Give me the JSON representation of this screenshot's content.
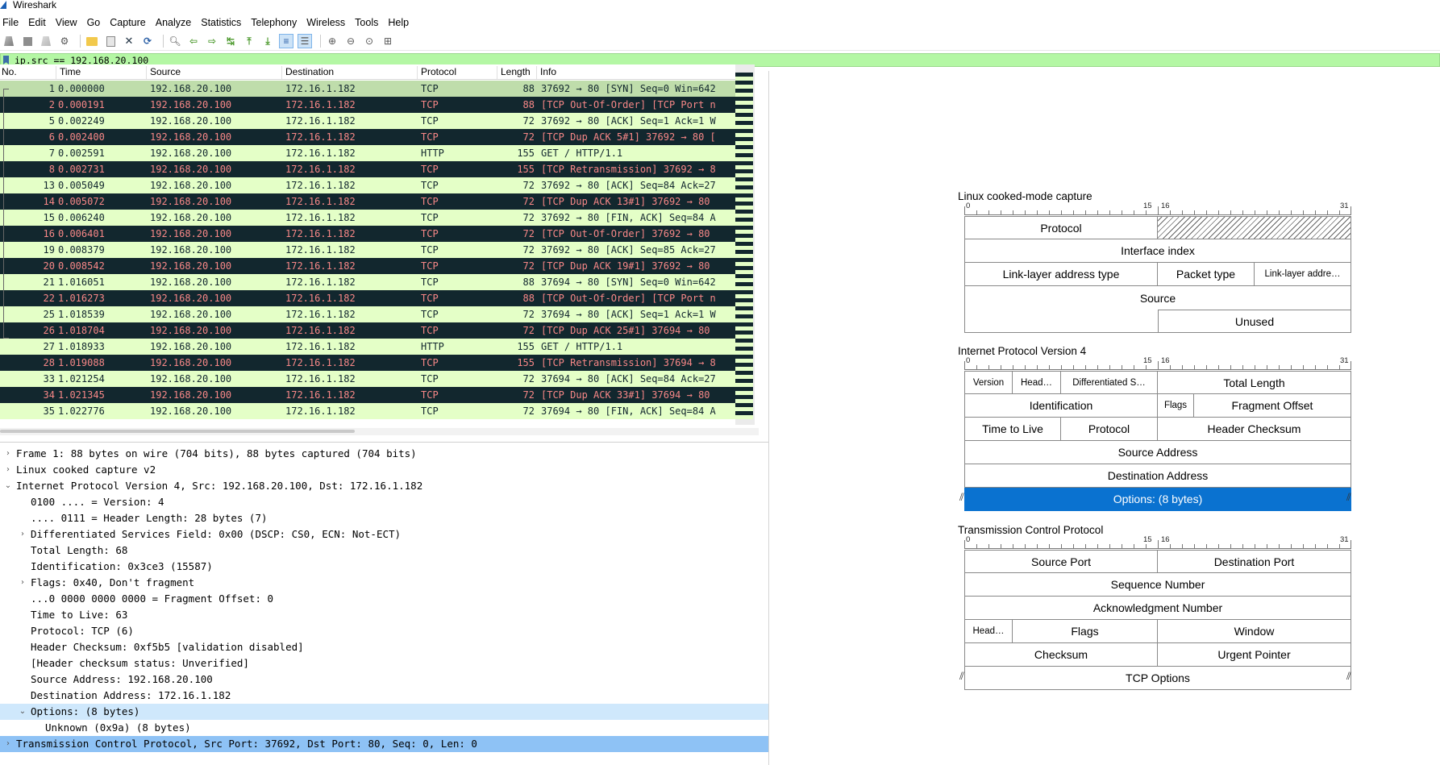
{
  "window": {
    "title": "Wireshark"
  },
  "menu": [
    "File",
    "Edit",
    "View",
    "Go",
    "Capture",
    "Analyze",
    "Statistics",
    "Telephony",
    "Wireless",
    "Tools",
    "Help"
  ],
  "toolbar": {
    "icons": [
      "start-capture-icon",
      "stop-capture-icon",
      "restart-capture-icon",
      "capture-options-icon",
      "open-file-icon",
      "save-file-icon",
      "close-file-icon",
      "reload-file-icon",
      "find-packet-icon",
      "go-back-icon",
      "go-forward-icon",
      "go-to-packet-icon",
      "first-packet-icon",
      "last-packet-icon",
      "auto-scroll-icon",
      "colorize-icon",
      "zoom-in-icon",
      "zoom-out-icon",
      "zoom-normal-icon",
      "resize-columns-icon"
    ]
  },
  "filter": {
    "value": "ip.src == 192.168.20.100"
  },
  "packet_list": {
    "columns": [
      "No.",
      "Time",
      "Source",
      "Destination",
      "Protocol",
      "Length",
      "Info"
    ],
    "rows": [
      {
        "no": "1",
        "time": "0.000000",
        "src": "192.168.20.100",
        "dst": "172.16.1.182",
        "proto": "TCP",
        "len": "88",
        "info": "37692 → 80 [SYN] Seq=0 Win=642",
        "style": "sel"
      },
      {
        "no": "2",
        "time": "0.000191",
        "src": "192.168.20.100",
        "dst": "172.16.1.182",
        "proto": "TCP",
        "len": "88",
        "info": "[TCP Out-Of-Order] [TCP Port n",
        "style": "bad"
      },
      {
        "no": "5",
        "time": "0.002249",
        "src": "192.168.20.100",
        "dst": "172.16.1.182",
        "proto": "TCP",
        "len": "72",
        "info": "37692 → 80 [ACK] Seq=1 Ack=1 W",
        "style": "ok"
      },
      {
        "no": "6",
        "time": "0.002400",
        "src": "192.168.20.100",
        "dst": "172.16.1.182",
        "proto": "TCP",
        "len": "72",
        "info": "[TCP Dup ACK 5#1] 37692 → 80 [",
        "style": "bad"
      },
      {
        "no": "7",
        "time": "0.002591",
        "src": "192.168.20.100",
        "dst": "172.16.1.182",
        "proto": "HTTP",
        "len": "155",
        "info": "GET / HTTP/1.1",
        "style": "ok"
      },
      {
        "no": "8",
        "time": "0.002731",
        "src": "192.168.20.100",
        "dst": "172.16.1.182",
        "proto": "TCP",
        "len": "155",
        "info": "[TCP Retransmission] 37692 → 8",
        "style": "bad"
      },
      {
        "no": "13",
        "time": "0.005049",
        "src": "192.168.20.100",
        "dst": "172.16.1.182",
        "proto": "TCP",
        "len": "72",
        "info": "37692 → 80 [ACK] Seq=84 Ack=27",
        "style": "ok"
      },
      {
        "no": "14",
        "time": "0.005072",
        "src": "192.168.20.100",
        "dst": "172.16.1.182",
        "proto": "TCP",
        "len": "72",
        "info": "[TCP Dup ACK 13#1] 37692 → 80",
        "style": "bad"
      },
      {
        "no": "15",
        "time": "0.006240",
        "src": "192.168.20.100",
        "dst": "172.16.1.182",
        "proto": "TCP",
        "len": "72",
        "info": "37692 → 80 [FIN, ACK] Seq=84 A",
        "style": "ok"
      },
      {
        "no": "16",
        "time": "0.006401",
        "src": "192.168.20.100",
        "dst": "172.16.1.182",
        "proto": "TCP",
        "len": "72",
        "info": "[TCP Out-Of-Order] 37692 → 80",
        "style": "bad"
      },
      {
        "no": "19",
        "time": "0.008379",
        "src": "192.168.20.100",
        "dst": "172.16.1.182",
        "proto": "TCP",
        "len": "72",
        "info": "37692 → 80 [ACK] Seq=85 Ack=27",
        "style": "ok"
      },
      {
        "no": "20",
        "time": "0.008542",
        "src": "192.168.20.100",
        "dst": "172.16.1.182",
        "proto": "TCP",
        "len": "72",
        "info": "[TCP Dup ACK 19#1] 37692 → 80",
        "style": "bad"
      },
      {
        "no": "21",
        "time": "1.016051",
        "src": "192.168.20.100",
        "dst": "172.16.1.182",
        "proto": "TCP",
        "len": "88",
        "info": "37694 → 80 [SYN] Seq=0 Win=642",
        "style": "ok"
      },
      {
        "no": "22",
        "time": "1.016273",
        "src": "192.168.20.100",
        "dst": "172.16.1.182",
        "proto": "TCP",
        "len": "88",
        "info": "[TCP Out-Of-Order] [TCP Port n",
        "style": "bad"
      },
      {
        "no": "25",
        "time": "1.018539",
        "src": "192.168.20.100",
        "dst": "172.16.1.182",
        "proto": "TCP",
        "len": "72",
        "info": "37694 → 80 [ACK] Seq=1 Ack=1 W",
        "style": "ok"
      },
      {
        "no": "26",
        "time": "1.018704",
        "src": "192.168.20.100",
        "dst": "172.16.1.182",
        "proto": "TCP",
        "len": "72",
        "info": "[TCP Dup ACK 25#1] 37694 → 80",
        "style": "bad"
      },
      {
        "no": "27",
        "time": "1.018933",
        "src": "192.168.20.100",
        "dst": "172.16.1.182",
        "proto": "HTTP",
        "len": "155",
        "info": "GET / HTTP/1.1",
        "style": "ok"
      },
      {
        "no": "28",
        "time": "1.019088",
        "src": "192.168.20.100",
        "dst": "172.16.1.182",
        "proto": "TCP",
        "len": "155",
        "info": "[TCP Retransmission] 37694 → 8",
        "style": "bad"
      },
      {
        "no": "33",
        "time": "1.021254",
        "src": "192.168.20.100",
        "dst": "172.16.1.182",
        "proto": "TCP",
        "len": "72",
        "info": "37694 → 80 [ACK] Seq=84 Ack=27",
        "style": "ok"
      },
      {
        "no": "34",
        "time": "1.021345",
        "src": "192.168.20.100",
        "dst": "172.16.1.182",
        "proto": "TCP",
        "len": "72",
        "info": "[TCP Dup ACK 33#1] 37694 → 80",
        "style": "bad"
      },
      {
        "no": "35",
        "time": "1.022776",
        "src": "192.168.20.100",
        "dst": "172.16.1.182",
        "proto": "TCP",
        "len": "72",
        "info": "37694 → 80 [FIN, ACK] Seq=84 A",
        "style": "ok"
      }
    ]
  },
  "details": [
    {
      "indent": 0,
      "arrow": "›",
      "text": "Frame 1: 88 bytes on wire (704 bits), 88 bytes captured (704 bits)",
      "hl": ""
    },
    {
      "indent": 0,
      "arrow": "›",
      "text": "Linux cooked capture v2",
      "hl": ""
    },
    {
      "indent": 0,
      "arrow": "⌄",
      "text": "Internet Protocol Version 4, Src: 192.168.20.100, Dst: 172.16.1.182",
      "hl": ""
    },
    {
      "indent": 1,
      "arrow": "",
      "text": "0100 .... = Version: 4",
      "hl": ""
    },
    {
      "indent": 1,
      "arrow": "",
      "text": ".... 0111 = Header Length: 28 bytes (7)",
      "hl": ""
    },
    {
      "indent": 1,
      "arrow": "›",
      "text": "Differentiated Services Field: 0x00 (DSCP: CS0, ECN: Not-ECT)",
      "hl": ""
    },
    {
      "indent": 1,
      "arrow": "",
      "text": "Total Length: 68",
      "hl": ""
    },
    {
      "indent": 1,
      "arrow": "",
      "text": "Identification: 0x3ce3 (15587)",
      "hl": ""
    },
    {
      "indent": 1,
      "arrow": "›",
      "text": "Flags: 0x40, Don't fragment",
      "hl": ""
    },
    {
      "indent": 1,
      "arrow": "",
      "text": "...0 0000 0000 0000 = Fragment Offset: 0",
      "hl": ""
    },
    {
      "indent": 1,
      "arrow": "",
      "text": "Time to Live: 63",
      "hl": ""
    },
    {
      "indent": 1,
      "arrow": "",
      "text": "Protocol: TCP (6)",
      "hl": ""
    },
    {
      "indent": 1,
      "arrow": "",
      "text": "Header Checksum: 0xf5b5 [validation disabled]",
      "hl": ""
    },
    {
      "indent": 1,
      "arrow": "",
      "text": "[Header checksum status: Unverified]",
      "hl": ""
    },
    {
      "indent": 1,
      "arrow": "",
      "text": "Source Address: 192.168.20.100",
      "hl": ""
    },
    {
      "indent": 1,
      "arrow": "",
      "text": "Destination Address: 172.16.1.182",
      "hl": ""
    },
    {
      "indent": 1,
      "arrow": "⌄",
      "text": "Options: (8 bytes)",
      "hl": "soft"
    },
    {
      "indent": 2,
      "arrow": "",
      "text": "Unknown (0x9a) (8 bytes)",
      "hl": ""
    },
    {
      "indent": 0,
      "arrow": "›",
      "text": "Transmission Control Protocol, Src Port: 37692, Dst Port: 80, Seq: 0, Len: 0",
      "hl": "full"
    }
  ],
  "diagram": {
    "ruler": {
      "start": "0",
      "mid_left": "15",
      "mid_right": "16",
      "end": "31"
    },
    "linux_cooked": {
      "title": "Linux cooked-mode capture",
      "protocol": "Protocol",
      "interface_index": "Interface index",
      "ll_addr_type": "Link-layer address type",
      "packet_type": "Packet type",
      "ll_addr_len": "Link-layer addre…",
      "source": "Source",
      "unused": "Unused"
    },
    "ipv4": {
      "title": "Internet Protocol Version 4",
      "version": "Version",
      "head": "Head…",
      "dsfield": "Differentiated S…",
      "total_length": "Total Length",
      "identification": "Identification",
      "flags": "Flags",
      "frag_offset": "Fragment Offset",
      "ttl": "Time to Live",
      "protocol": "Protocol",
      "checksum": "Header Checksum",
      "src": "Source Address",
      "dst": "Destination Address",
      "options": "Options: (8 bytes)"
    },
    "tcp": {
      "title": "Transmission Control Protocol",
      "src_port": "Source Port",
      "dst_port": "Destination Port",
      "seq": "Sequence Number",
      "ack": "Acknowledgment Number",
      "head": "Head…",
      "flags": "Flags",
      "window": "Window",
      "checksum": "Checksum",
      "urgent": "Urgent Pointer",
      "options": "TCP Options"
    }
  },
  "colors": {
    "filter_ok": "#b4f7a4",
    "row_ok_bg": "#e4ffc7",
    "row_bad_bg": "#12272e",
    "row_bad_fg": "#f78787",
    "row_selected_bg": "#bfddab",
    "detail_selected": "#8ec2f5",
    "diagram_selected": "#0a72d0"
  }
}
